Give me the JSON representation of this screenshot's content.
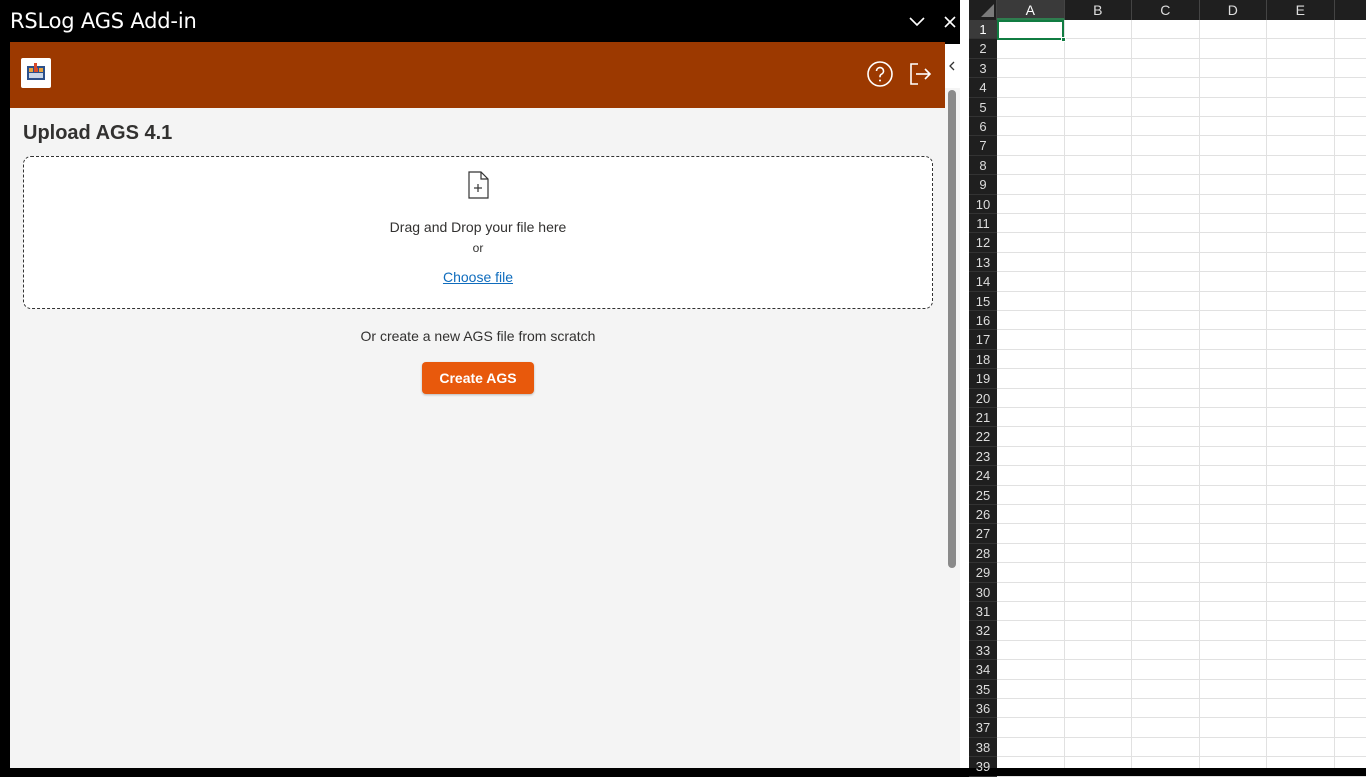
{
  "taskpane": {
    "title": "RSLog AGS Add-in",
    "collapse_icon": "chevron-down-icon",
    "close_icon": "close-icon"
  },
  "addin": {
    "header_color": "#9c3900",
    "logo_icon": "rslog-logo-icon",
    "help_icon": "help-circle-icon",
    "signout_icon": "sign-out-icon",
    "upload_title": "Upload AGS 4.1",
    "dropzone": {
      "icon": "file-add-icon",
      "drag_text": "Drag and Drop your file here",
      "or_text": "or",
      "choose_file_label": "Choose file"
    },
    "scratch_text": "Or create a new AGS file from scratch",
    "create_button_label": "Create AGS",
    "accent_color": "#e8590c",
    "link_color": "#0f6cbd"
  },
  "sheet": {
    "columns": [
      "A",
      "B",
      "C",
      "D",
      "E"
    ],
    "rows": [
      "1",
      "2",
      "3",
      "4",
      "5",
      "6",
      "7",
      "8",
      "9",
      "10",
      "11",
      "12",
      "13",
      "14",
      "15",
      "16",
      "17",
      "18",
      "19",
      "20",
      "21",
      "22",
      "23",
      "24",
      "25",
      "26",
      "27",
      "28",
      "29",
      "30",
      "31",
      "32",
      "33",
      "34",
      "35",
      "36",
      "37",
      "38",
      "39"
    ],
    "selected_cell": "A1",
    "selection_color": "#107c41"
  }
}
